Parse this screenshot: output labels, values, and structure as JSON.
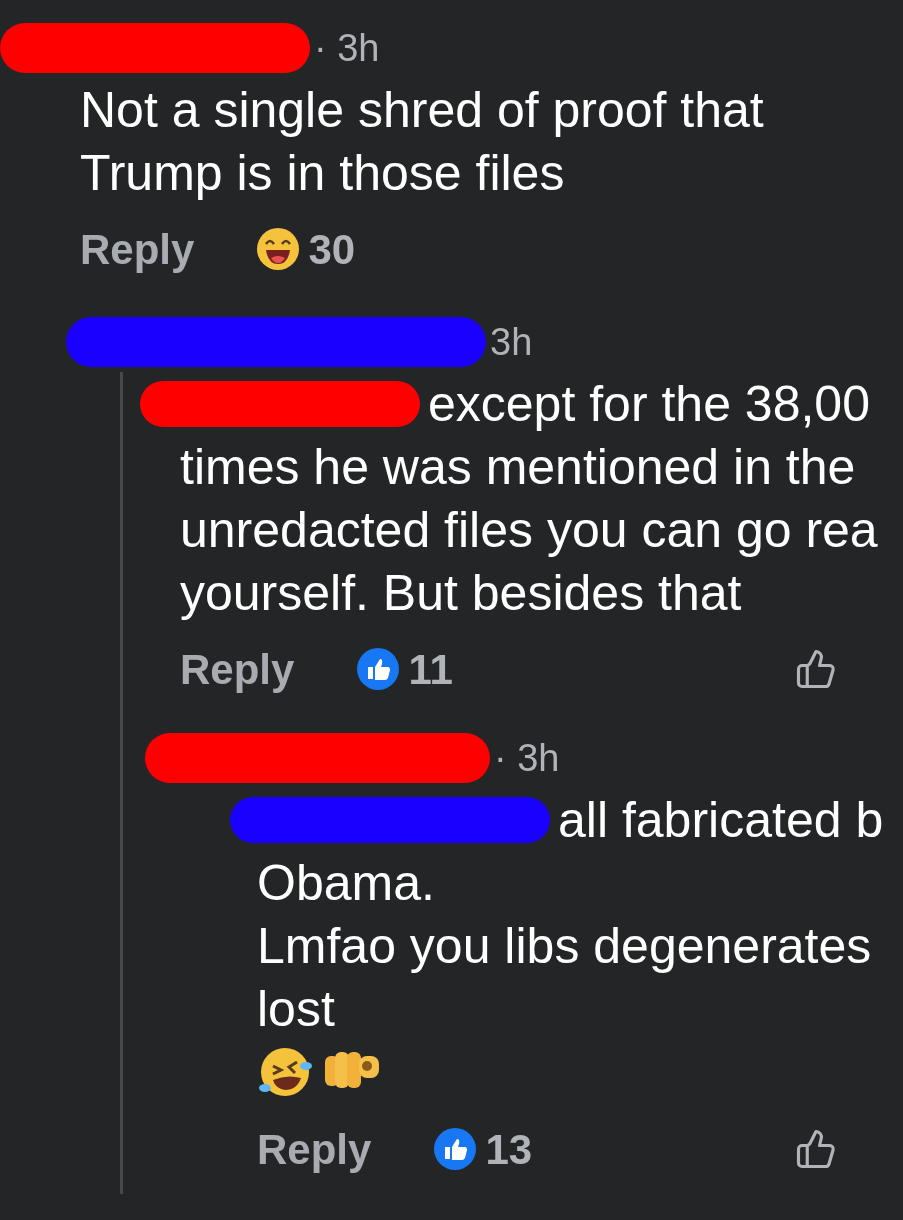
{
  "comments": [
    {
      "name_mark": {
        "color": "#ff0000"
      },
      "time": "· 3h",
      "lines": [
        "Not a single shred of proof that",
        "Trump is in those files"
      ],
      "reply": "Reply",
      "reaction": {
        "kind": "laugh",
        "count": "30"
      },
      "replies": [
        {
          "name_mark": {
            "color": "#1a00ff"
          },
          "time": "3h",
          "mention_mark": {
            "color": "#ff0000"
          },
          "lines": [
            "except for the 38,00",
            "times he was mentioned in the",
            "unredacted files you can go rea",
            "yourself. But besides that"
          ],
          "reply": "Reply",
          "reaction": {
            "kind": "like",
            "count": "11"
          },
          "like_button": true
        },
        {
          "name_mark": {
            "color": "#ff0000"
          },
          "time": "· 3h",
          "mention_mark": {
            "color": "#1a00ff"
          },
          "lines": [
            "all fabricated b",
            "Obama.",
            "Lmfao you libs degenerates",
            "lost"
          ],
          "trailing_emojis": true,
          "reply": "Reply",
          "reaction": {
            "kind": "like",
            "count": "13"
          },
          "like_button": true
        }
      ]
    }
  ]
}
